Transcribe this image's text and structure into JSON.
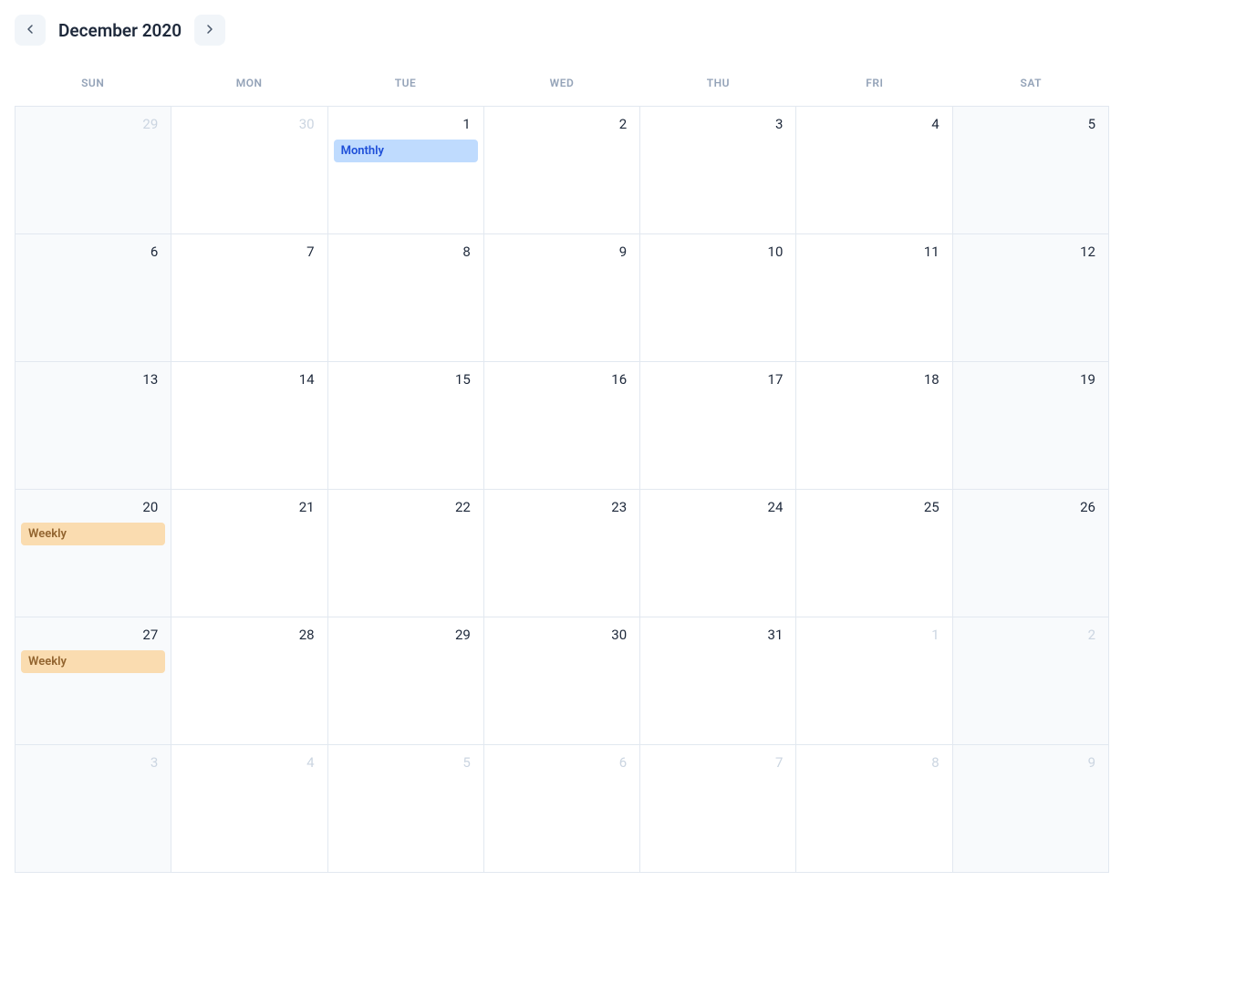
{
  "header": {
    "title": "December 2020"
  },
  "dayOfWeek": [
    "SUN",
    "MON",
    "TUE",
    "WED",
    "THU",
    "FRI",
    "SAT"
  ],
  "weeks": [
    [
      {
        "d": "29",
        "other": true,
        "weekend": true,
        "events": []
      },
      {
        "d": "30",
        "other": true,
        "weekend": false,
        "events": []
      },
      {
        "d": "1",
        "other": false,
        "weekend": false,
        "events": [
          {
            "label": "Monthly",
            "type": "monthly"
          }
        ]
      },
      {
        "d": "2",
        "other": false,
        "weekend": false,
        "events": []
      },
      {
        "d": "3",
        "other": false,
        "weekend": false,
        "events": []
      },
      {
        "d": "4",
        "other": false,
        "weekend": false,
        "events": []
      },
      {
        "d": "5",
        "other": false,
        "weekend": true,
        "events": []
      }
    ],
    [
      {
        "d": "6",
        "other": false,
        "weekend": true,
        "events": []
      },
      {
        "d": "7",
        "other": false,
        "weekend": false,
        "events": []
      },
      {
        "d": "8",
        "other": false,
        "weekend": false,
        "events": []
      },
      {
        "d": "9",
        "other": false,
        "weekend": false,
        "events": []
      },
      {
        "d": "10",
        "other": false,
        "weekend": false,
        "events": []
      },
      {
        "d": "11",
        "other": false,
        "weekend": false,
        "events": []
      },
      {
        "d": "12",
        "other": false,
        "weekend": true,
        "events": []
      }
    ],
    [
      {
        "d": "13",
        "other": false,
        "weekend": true,
        "events": []
      },
      {
        "d": "14",
        "other": false,
        "weekend": false,
        "events": []
      },
      {
        "d": "15",
        "other": false,
        "weekend": false,
        "events": []
      },
      {
        "d": "16",
        "other": false,
        "weekend": false,
        "events": []
      },
      {
        "d": "17",
        "other": false,
        "weekend": false,
        "events": []
      },
      {
        "d": "18",
        "other": false,
        "weekend": false,
        "events": []
      },
      {
        "d": "19",
        "other": false,
        "weekend": true,
        "events": []
      }
    ],
    [
      {
        "d": "20",
        "other": false,
        "weekend": true,
        "events": [
          {
            "label": "Weekly",
            "type": "weekly"
          }
        ]
      },
      {
        "d": "21",
        "other": false,
        "weekend": false,
        "events": []
      },
      {
        "d": "22",
        "other": false,
        "weekend": false,
        "events": []
      },
      {
        "d": "23",
        "other": false,
        "weekend": false,
        "events": []
      },
      {
        "d": "24",
        "other": false,
        "weekend": false,
        "events": []
      },
      {
        "d": "25",
        "other": false,
        "weekend": false,
        "events": []
      },
      {
        "d": "26",
        "other": false,
        "weekend": true,
        "events": []
      }
    ],
    [
      {
        "d": "27",
        "other": false,
        "weekend": true,
        "events": [
          {
            "label": "Weekly",
            "type": "weekly"
          }
        ]
      },
      {
        "d": "28",
        "other": false,
        "weekend": false,
        "events": []
      },
      {
        "d": "29",
        "other": false,
        "weekend": false,
        "events": []
      },
      {
        "d": "30",
        "other": false,
        "weekend": false,
        "events": []
      },
      {
        "d": "31",
        "other": false,
        "weekend": false,
        "events": []
      },
      {
        "d": "1",
        "other": true,
        "weekend": false,
        "events": []
      },
      {
        "d": "2",
        "other": true,
        "weekend": true,
        "events": []
      }
    ],
    [
      {
        "d": "3",
        "other": true,
        "weekend": true,
        "events": []
      },
      {
        "d": "4",
        "other": true,
        "weekend": false,
        "events": []
      },
      {
        "d": "5",
        "other": true,
        "weekend": false,
        "events": []
      },
      {
        "d": "6",
        "other": true,
        "weekend": false,
        "events": []
      },
      {
        "d": "7",
        "other": true,
        "weekend": false,
        "events": []
      },
      {
        "d": "8",
        "other": true,
        "weekend": false,
        "events": []
      },
      {
        "d": "9",
        "other": true,
        "weekend": true,
        "events": []
      }
    ]
  ]
}
